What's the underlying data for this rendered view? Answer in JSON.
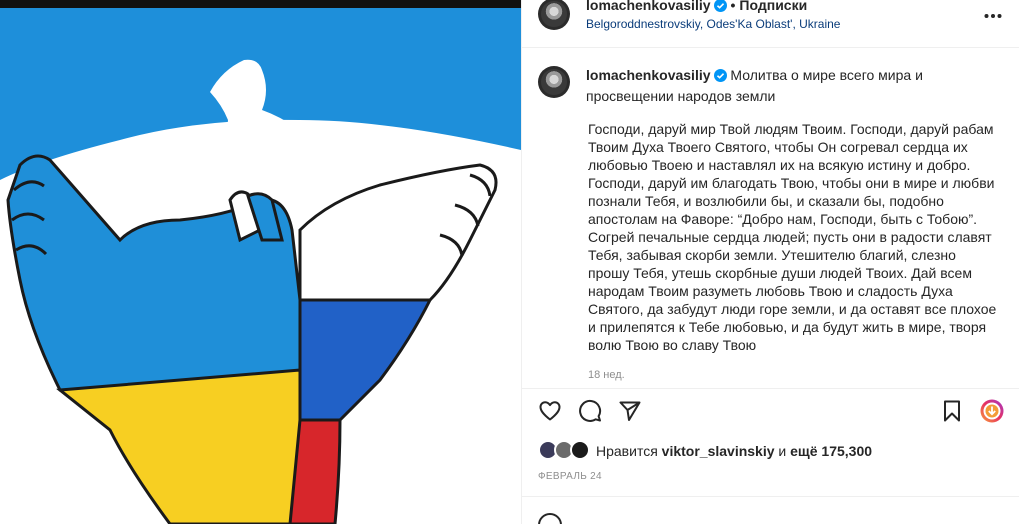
{
  "header": {
    "username": "lomachenkovasiliy",
    "follow_label": "Подписки",
    "location": "Belgoroddnestrovskiy, Odes'Ka Oblast', Ukraine",
    "more_icon": "more-horizontal-icon"
  },
  "caption": {
    "username": "lomachenkovasiliy",
    "title": "Молитва о мире всего мира и просвещении народов земли",
    "body": "Господи, даруй мир Твой людям Твоим. Господи, даруй рабам Твоим Духа Твоего Святого, чтобы Он согревал сердца их любовью Твоею и наставлял их на всякую истину и добро. Господи, даруй им благодать Твою, чтобы они в мире и любви познали Тебя, и возлюбили бы, и сказали бы, подобно апостолам на Фаворе: “Добро нам, Господи, быть с Тобою”. Согрей печальные сердца людей; пусть они в радости славят Тебя, забывая скорби земли. Утешителю благий, слезно прошу Тебя, утешь скорбные души людей Твоих. Дай всем народам Твоим разуметь любовь Твою и сладость Духа Святого, да забудут люди горе земли, и да оставят все плохое и прилепятся к Тебе любовью, и да будут жить в мире, творя волю Твою во славу Твою",
    "time": "18 нед."
  },
  "actions": {
    "like_icon": "heart-icon",
    "comment_icon": "comment-icon",
    "share_icon": "paper-plane-icon",
    "save_icon": "bookmark-icon",
    "extra_icon": "download-icon"
  },
  "likes": {
    "prefix": "Нравится",
    "user": "viktor_slavinskiy",
    "joiner": "и",
    "others": "ещё 175,300"
  },
  "date": "ФЕВРАЛЬ 24",
  "comment": {
    "placeholder": "",
    "post_label": ""
  },
  "colors": {
    "ukraine_blue": "#1f8fd8",
    "ukraine_yellow": "#f7cf22",
    "russia_blue": "#2161c7",
    "russia_red": "#d7262b",
    "sky_blue": "#1e8fda",
    "link_blue": "#0a3c7a",
    "verified": "#0095f6"
  }
}
